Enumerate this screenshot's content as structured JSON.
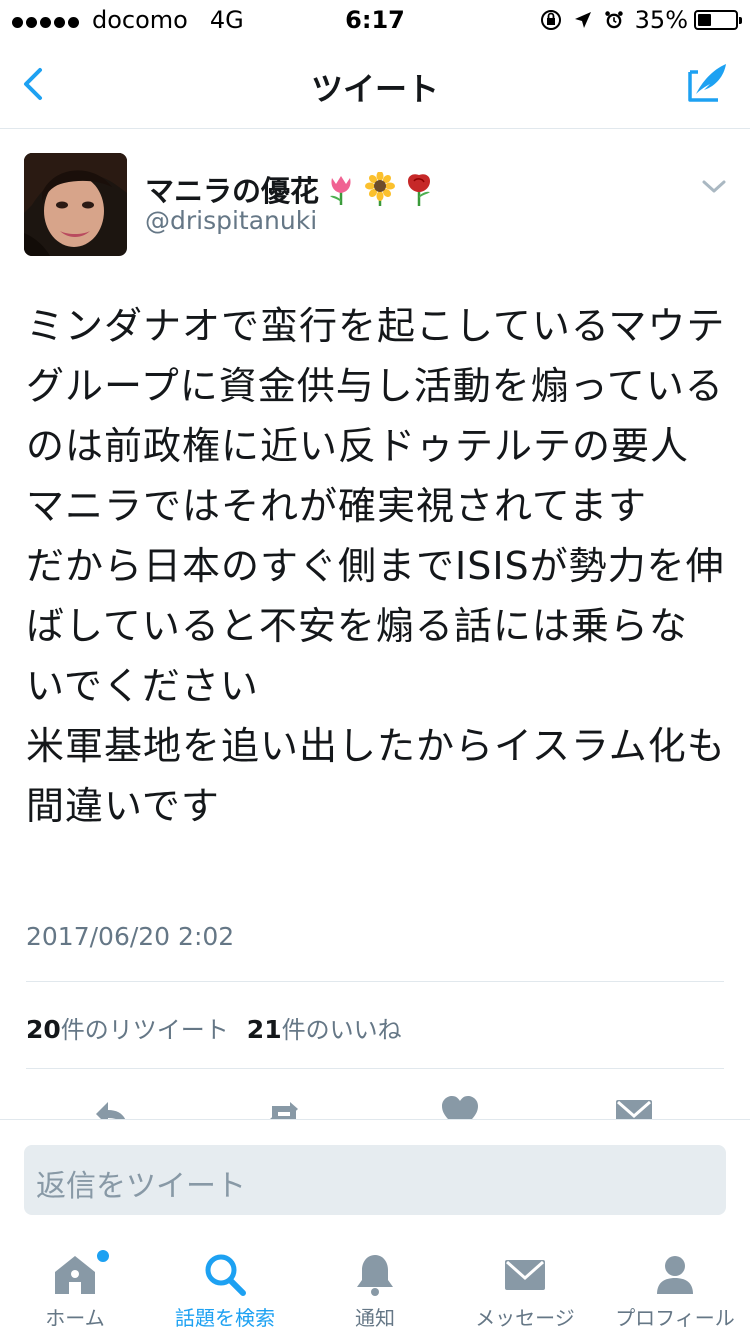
{
  "status_bar": {
    "carrier": "docomo",
    "network": "4G",
    "time": "6:17",
    "battery": "35%",
    "battery_level": 0.35,
    "icons": [
      "orientation-lock-icon",
      "location-arrow-icon",
      "alarm-icon"
    ]
  },
  "nav": {
    "title": "ツイート",
    "back_icon": "chevron-left-icon",
    "compose_icon": "compose-tweet-icon"
  },
  "tweet": {
    "display_name": "マニラの優花",
    "emojis": [
      "tulip",
      "sunflower",
      "rose"
    ],
    "handle": "@drispitanuki",
    "text": "ミンダナオで蛮行を起こしているマウテ グループに資金供与し活動を煽っているのは前政権に近い反ドゥテルテの要人\nマニラではそれが確実視されてます\nだから日本のすぐ側までISISが勢力を伸ばしていると不安を煽る話には乗らないでください\n米軍基地を追い出したからイスラム化も間違いです",
    "timestamp": "2017/06/20 2:02",
    "retweet_count": "20",
    "retweet_label": "件のリツイート",
    "like_count": "21",
    "like_label": "件のいいね"
  },
  "actions": [
    "reply-icon",
    "retweet-icon",
    "like-icon",
    "message-icon"
  ],
  "reply": {
    "placeholder": "返信をツイート"
  },
  "tabbar": {
    "tabs": [
      {
        "label": "ホーム",
        "icon": "home-icon"
      },
      {
        "label": "話題を検索",
        "icon": "search-icon"
      },
      {
        "label": "通知",
        "icon": "bell-icon"
      },
      {
        "label": "メッセージ",
        "icon": "envelope-icon"
      },
      {
        "label": "プロフィール",
        "icon": "profile-icon"
      }
    ],
    "active_index": 1,
    "accent_color": "#1da1f2"
  },
  "colors": {
    "accent": "#1da1f2",
    "secondary_text": "#657786",
    "icon_gray": "#8899a6",
    "divider": "#e1e8ed"
  }
}
